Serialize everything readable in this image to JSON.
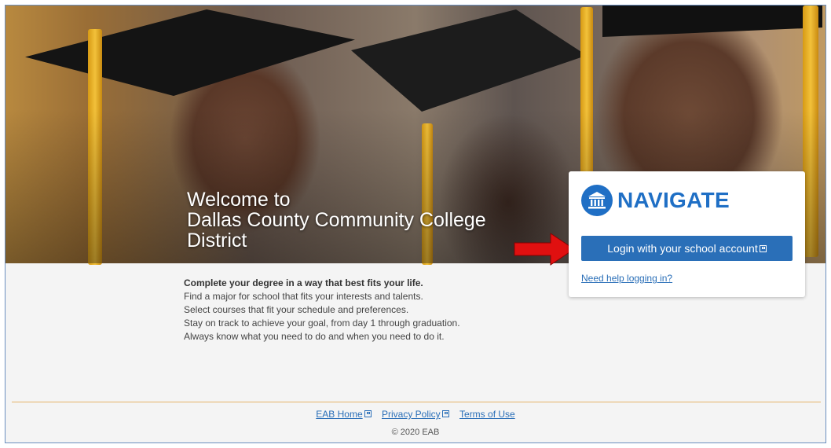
{
  "hero": {
    "welcome_line1": "Welcome to",
    "welcome_line2": "Dallas County Community College",
    "welcome_line3": "District"
  },
  "card": {
    "logo_text": "NAVIGATE",
    "logo_icon": "institution-icon",
    "login_button": "Login with your school account",
    "help_link": "Need help logging in?"
  },
  "description": {
    "lead": "Complete your degree in a way that best fits your life.",
    "lines": [
      "Find a major for school that fits your interests and talents.",
      "Select courses that fit your schedule and preferences.",
      "Stay on track to achieve your goal, from day 1 through graduation.",
      "Always know what you need to do and when you need to do it."
    ]
  },
  "footer": {
    "links": [
      "EAB Home",
      "Privacy Policy",
      "Terms of Use"
    ],
    "copyright": "© 2020 EAB"
  },
  "colors": {
    "brand_blue": "#1f6fc5",
    "button_blue": "#2a6fb8",
    "arrow_red": "#e01010",
    "footer_rule": "#e4b36a"
  }
}
